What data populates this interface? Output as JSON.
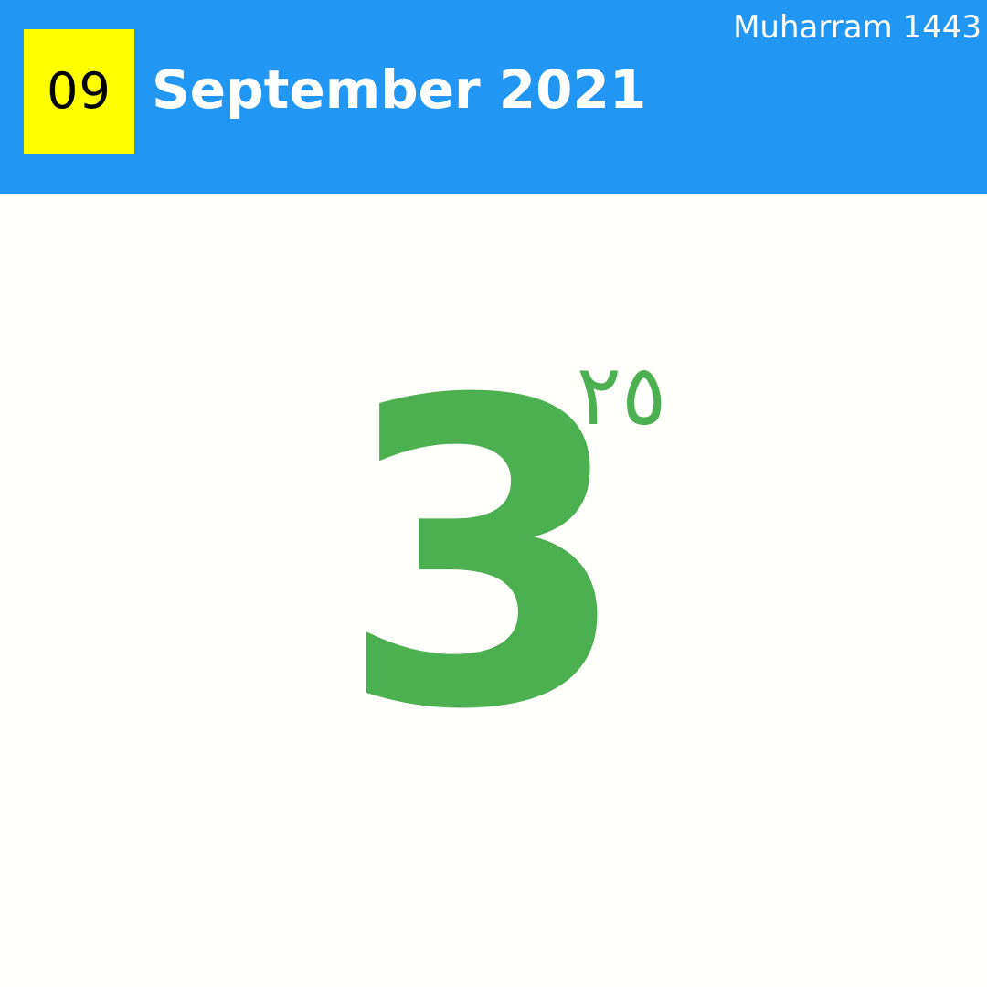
{
  "header": {
    "month_number": "09",
    "month_year": "September 2021",
    "hijri_month_year": "Muharram 1443"
  },
  "day": {
    "gregorian": "3",
    "hijri": "٢٥"
  },
  "colors": {
    "header_background": "#2196f3",
    "badge_background": "#ffff00",
    "day_text": "#4caf50",
    "page_background": "#fffffc"
  }
}
